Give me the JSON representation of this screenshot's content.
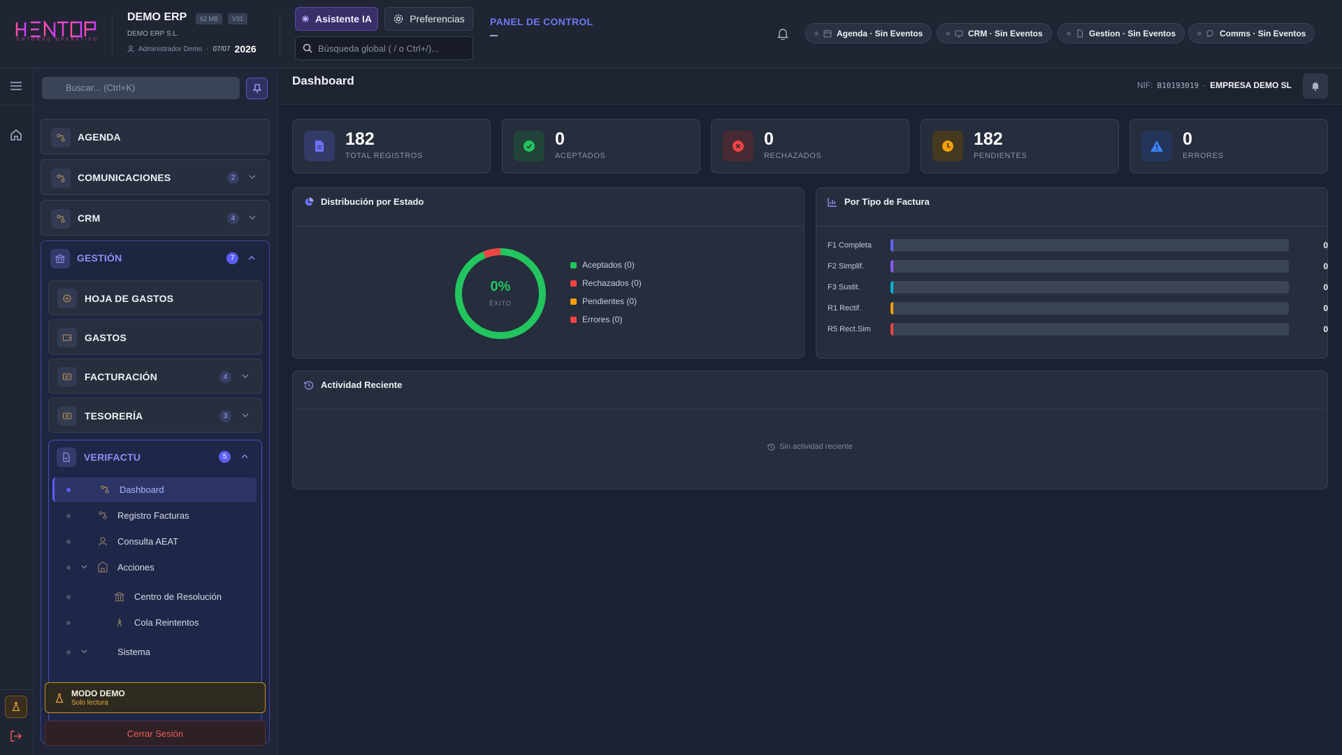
{
  "brand": {
    "logo_text": "HENTOP",
    "logo_sub": "ENTORNO OPERATIVO"
  },
  "header": {
    "app_name": "DEMO ERP",
    "size_badge": "62 MB",
    "version_badge": "V31",
    "company": "DEMO ERP S.L.",
    "user": "Administrador Demo",
    "separator": "·",
    "date": "07/07",
    "year": "2026",
    "ai_button": "Asistente IA",
    "prefs_button": "Preferencias",
    "search_placeholder": "Búsqueda global ( / o Ctrl+/)...",
    "panel_title": "PANEL DE CONTROL",
    "events": [
      {
        "label": "Agenda · Sin Eventos",
        "icon": "calendar-icon"
      },
      {
        "label": "CRM · Sin Eventos",
        "icon": "monitor-icon"
      },
      {
        "label": "Gestion · Sin Eventos",
        "icon": "document-icon"
      },
      {
        "label": "Comms · Sin Eventos",
        "icon": "chat-icon"
      }
    ]
  },
  "sidebar": {
    "search_placeholder": "Buscar... (Ctrl+K)",
    "modules": [
      {
        "label": "AGENDA"
      },
      {
        "label": "COMUNICACIONES",
        "badge": "2"
      },
      {
        "label": "CRM",
        "badge": "4"
      },
      {
        "label": "GESTIÓN",
        "badge": "7"
      }
    ],
    "gestion_items": [
      {
        "label": "HOJA DE GASTOS"
      },
      {
        "label": "GASTOS"
      },
      {
        "label": "FACTURACIÓN",
        "badge": "4"
      },
      {
        "label": "TESORERÍA",
        "badge": "3"
      },
      {
        "label": "VERIFACTU",
        "badge": "5"
      }
    ],
    "verifactu_items": [
      {
        "label": "Dashboard",
        "active": true
      },
      {
        "label": "Registro Facturas"
      },
      {
        "label": "Consulta AEAT"
      },
      {
        "label": "Acciones"
      },
      {
        "label": "Centro de Resolución"
      },
      {
        "label": "Cola Reintentos"
      },
      {
        "label": "Sistema"
      }
    ],
    "demo_title": "MODO DEMO",
    "demo_sub": "Solo lectura",
    "logout": "Cerrar Sesión"
  },
  "main": {
    "title": "Dashboard",
    "nif_label": "NIF:",
    "nif_value": "B10193019",
    "separator": "·",
    "company": "EMPRESA DEMO SL",
    "stats": [
      {
        "value": "182",
        "label": "TOTAL REGISTROS",
        "color": "#5b5ff2"
      },
      {
        "value": "0",
        "label": "ACEPTADOS",
        "color": "#22c55e"
      },
      {
        "value": "0",
        "label": "RECHAZADOS",
        "color": "#ef4444"
      },
      {
        "value": "182",
        "label": "PENDIENTES",
        "color": "#f59e0b"
      },
      {
        "value": "0",
        "label": "ERRORES",
        "color": "#3b82f6"
      }
    ],
    "distribution": {
      "title": "Distribución por Estado",
      "center_value": "0%",
      "center_label": "ÉXITO",
      "legend": [
        {
          "label": "Aceptados (0)",
          "color": "#22c55e"
        },
        {
          "label": "Rechazados (0)",
          "color": "#ef4444"
        },
        {
          "label": "Pendientes (0)",
          "color": "#f59e0b"
        },
        {
          "label": "Errores (0)",
          "color": "#ef4444"
        }
      ]
    },
    "by_type": {
      "title": "Por Tipo de Factura",
      "rows": [
        {
          "label": "F1 Completa",
          "value": "0",
          "color": "#6366f1"
        },
        {
          "label": "F2 Simplif.",
          "value": "0",
          "color": "#8b5cf6"
        },
        {
          "label": "F3 Sustit.",
          "value": "0",
          "color": "#06b6d4"
        },
        {
          "label": "R1 Rectif.",
          "value": "0",
          "color": "#f59e0b"
        },
        {
          "label": "R5 Rect.Sim",
          "value": "0",
          "color": "#ef4444"
        }
      ]
    },
    "activity": {
      "title": "Actividad Reciente",
      "empty": "Sin actividad reciente"
    }
  }
}
